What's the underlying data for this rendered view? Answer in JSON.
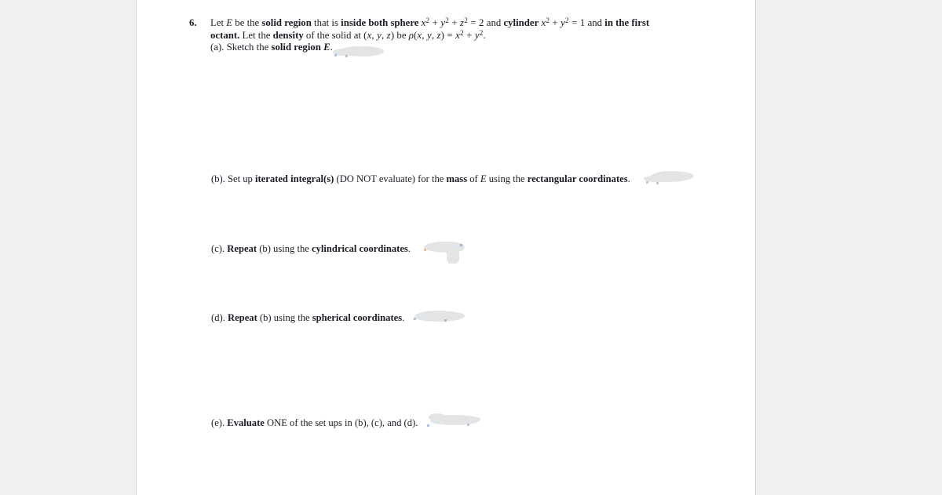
{
  "document": {
    "kind": "scanned-worksheet-page",
    "background_color": "#f0f0f1",
    "page_color": "#ffffff",
    "text_color": "#1b1b24",
    "redaction_color": "#e3e4e6"
  },
  "problem": {
    "number": "6.",
    "stem": {
      "line1": {
        "seg1": "Let ",
        "var_E": "E",
        "seg2": " be the ",
        "bold1": "solid region",
        "seg3": " that is ",
        "bold2": "inside both sphere",
        "eq_sphere": "x² + y² + z² = 2",
        "seg4": " and ",
        "bold3": "cylinder",
        "eq_cylinder": "x² + y² = 1",
        "seg5": " and ",
        "bold4": "in the first"
      },
      "line2": {
        "bold1": "octant.",
        "seg1": " Let the ",
        "bold2": "density",
        "seg2": " of the solid at ",
        "point": "(x, y, z)",
        "seg3": " be ",
        "density_eq": "ρ(x, y, z) = x² + y²",
        "period": "."
      }
    },
    "parts": [
      {
        "id": "a",
        "label": "(a).",
        "text_plain": "Sketch the ",
        "text_bold": "solid region",
        "text_var": "E",
        "text_tail": ".",
        "redacted": true
      },
      {
        "id": "b",
        "label": "(b).",
        "seg1": "Set up ",
        "bold1": "iterated integral(s)",
        "seg2": " (DO NOT evaluate) for the ",
        "bold2": "mass",
        "seg3": " of ",
        "var": "E",
        "seg4": " using the ",
        "bold3": "rectangular coordinates",
        "seg5": ".",
        "redacted": true
      },
      {
        "id": "c",
        "label": "(c).",
        "seg1": "",
        "bold1": "Repeat",
        "seg2": " (b) using the ",
        "bold2": "cylindrical coordinates",
        "seg3": ".",
        "redacted": true
      },
      {
        "id": "d",
        "label": "(d).",
        "seg1": "",
        "bold1": "Repeat",
        "seg2": " (b) using the ",
        "bold2": "spherical coordinates",
        "seg3": ".",
        "redacted": true
      },
      {
        "id": "e",
        "label": "(e).",
        "seg1": "",
        "bold1": "Evaluate",
        "seg2": " ONE of the set ups in (b), (c), and (d).",
        "redacted": true
      }
    ]
  }
}
